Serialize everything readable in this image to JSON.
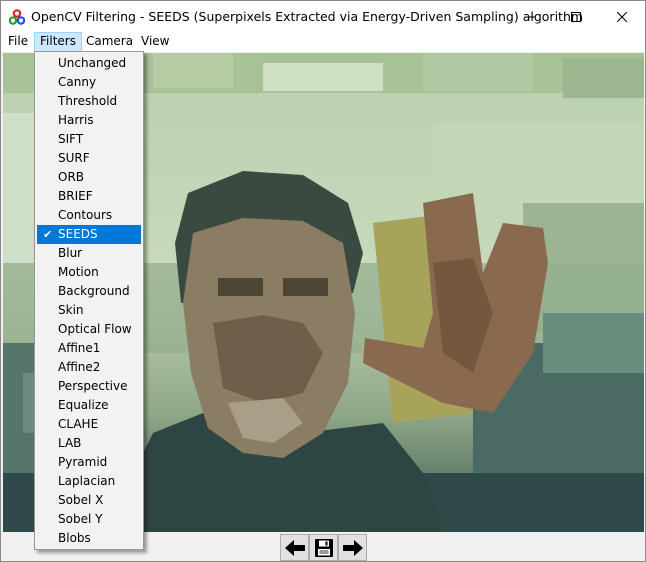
{
  "window": {
    "title": "OpenCV Filtering - SEEDS (Superpixels Extracted via Energy-Driven Sampling) algorithm",
    "app_icon": "opencv-logo-icon",
    "controls": [
      "minimize-icon",
      "maximize-icon",
      "close-icon"
    ]
  },
  "menubar": {
    "file": "File",
    "filters": "Filters",
    "camera": "Camera",
    "view": "View",
    "active_menu": "Filters"
  },
  "filters_menu": {
    "items": [
      {
        "label": "Unchanged"
      },
      {
        "label": "Canny"
      },
      {
        "label": "Threshold"
      },
      {
        "label": "Harris"
      },
      {
        "label": "SIFT"
      },
      {
        "label": "SURF"
      },
      {
        "label": "ORB"
      },
      {
        "label": "BRIEF"
      },
      {
        "label": "Contours"
      },
      {
        "label": "SEEDS",
        "checked": true
      },
      {
        "label": "Blur"
      },
      {
        "label": "Motion"
      },
      {
        "label": "Background"
      },
      {
        "label": "Skin"
      },
      {
        "label": "Optical Flow"
      },
      {
        "label": "Affine1"
      },
      {
        "label": "Affine2"
      },
      {
        "label": "Perspective"
      },
      {
        "label": "Equalize"
      },
      {
        "label": "CLAHE"
      },
      {
        "label": "LAB"
      },
      {
        "label": "Pyramid"
      },
      {
        "label": "Laplacian"
      },
      {
        "label": "Sobel X"
      },
      {
        "label": "Sobel Y"
      },
      {
        "label": "Blobs"
      }
    ],
    "check_glyph": "✔",
    "selected_bg": "#0078d7"
  },
  "toolbar": {
    "buttons": [
      "arrow-left-icon",
      "floppy-disk-save-icon",
      "arrow-right-icon"
    ]
  }
}
